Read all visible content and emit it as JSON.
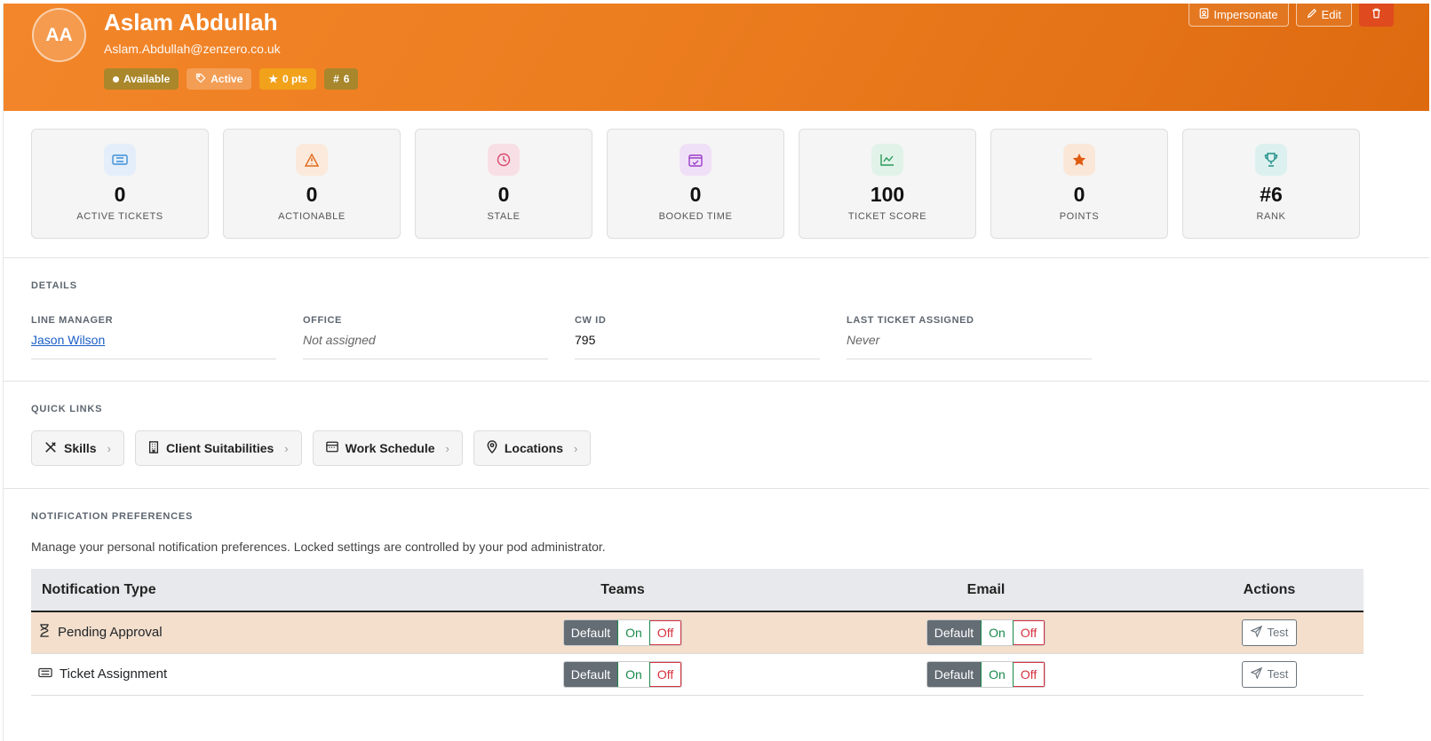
{
  "header": {
    "initials": "AA",
    "name": "Aslam Abdullah",
    "email": "Aslam.Abdullah@zenzero.co.uk",
    "badges": {
      "availability": "Available",
      "status": "Active",
      "points": "0 pts",
      "rank": "6"
    },
    "actions": {
      "impersonate": "Impersonate",
      "edit": "Edit"
    }
  },
  "stats": [
    {
      "value": "0",
      "label": "ACTIVE TICKETS",
      "icon": "ticket-icon",
      "color": "#3d8fd8",
      "bg": "#e3eefa"
    },
    {
      "value": "0",
      "label": "ACTIONABLE",
      "icon": "warning-icon",
      "color": "#e06a1a",
      "bg": "#fbe9db"
    },
    {
      "value": "0",
      "label": "STALE",
      "icon": "clock-icon",
      "color": "#d84a6a",
      "bg": "#f8dfe6"
    },
    {
      "value": "0",
      "label": "BOOKED TIME",
      "icon": "calendar-check-icon",
      "color": "#9b3fc9",
      "bg": "#f0e0f7"
    },
    {
      "value": "100",
      "label": "TICKET SCORE",
      "icon": "chart-line-icon",
      "color": "#2b9a5a",
      "bg": "#e1f3e8"
    },
    {
      "value": "0",
      "label": "POINTS",
      "icon": "star-icon",
      "color": "#e05a10",
      "bg": "#fbe7d8"
    },
    {
      "value": "#6",
      "label": "RANK",
      "icon": "trophy-icon",
      "color": "#1f8f86",
      "bg": "#dcf1ef"
    }
  ],
  "details": {
    "title": "DETAILS",
    "line_manager": {
      "label": "LINE MANAGER",
      "value": "Jason Wilson"
    },
    "office": {
      "label": "OFFICE",
      "value": "Not assigned"
    },
    "cw_id": {
      "label": "CW ID",
      "value": "795"
    },
    "last_ticket": {
      "label": "LAST TICKET ASSIGNED",
      "value": "Never"
    }
  },
  "quick_links": {
    "title": "QUICK LINKS",
    "items": [
      "Skills",
      "Client Suitabilities",
      "Work Schedule",
      "Locations"
    ]
  },
  "notifications": {
    "title": "NOTIFICATION PREFERENCES",
    "description": "Manage your personal notification preferences. Locked settings are controlled by your pod administrator.",
    "columns": [
      "Notification Type",
      "Teams",
      "Email",
      "Actions"
    ],
    "toggle": {
      "default": "Default",
      "on": "On",
      "off": "Off"
    },
    "test_label": "Test",
    "rows": [
      {
        "type": "Pending Approval",
        "icon": "hourglass-icon"
      },
      {
        "type": "Ticket Assignment",
        "icon": "ticket-icon"
      }
    ]
  }
}
